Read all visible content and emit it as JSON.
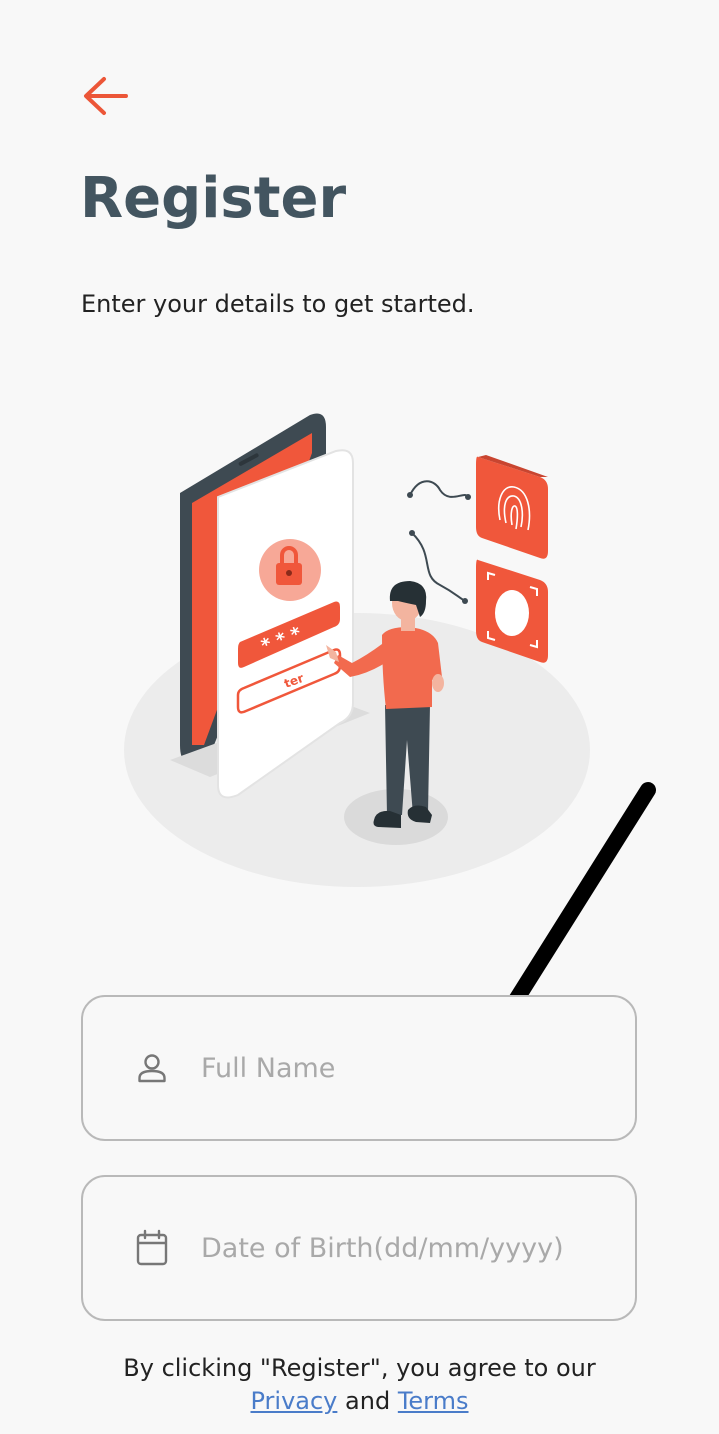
{
  "header": {
    "back_icon": "arrow-left-icon",
    "title": "Register",
    "subtitle": "Enter your details to get started."
  },
  "illustration": {
    "password_button_label": "ter"
  },
  "form": {
    "full_name": {
      "icon": "user-icon",
      "placeholder": "Full Name",
      "value": ""
    },
    "dob": {
      "icon": "calendar-icon",
      "placeholder": "Date of Birth(dd/mm/yyyy)",
      "value": ""
    }
  },
  "terms": {
    "prefix": "By clicking \"Register\", you agree to our",
    "privacy_label": "Privacy",
    "and": "and",
    "terms_label": "Terms"
  },
  "colors": {
    "accent": "#f0573b",
    "title": "#435560",
    "link": "#4a7cc9"
  }
}
